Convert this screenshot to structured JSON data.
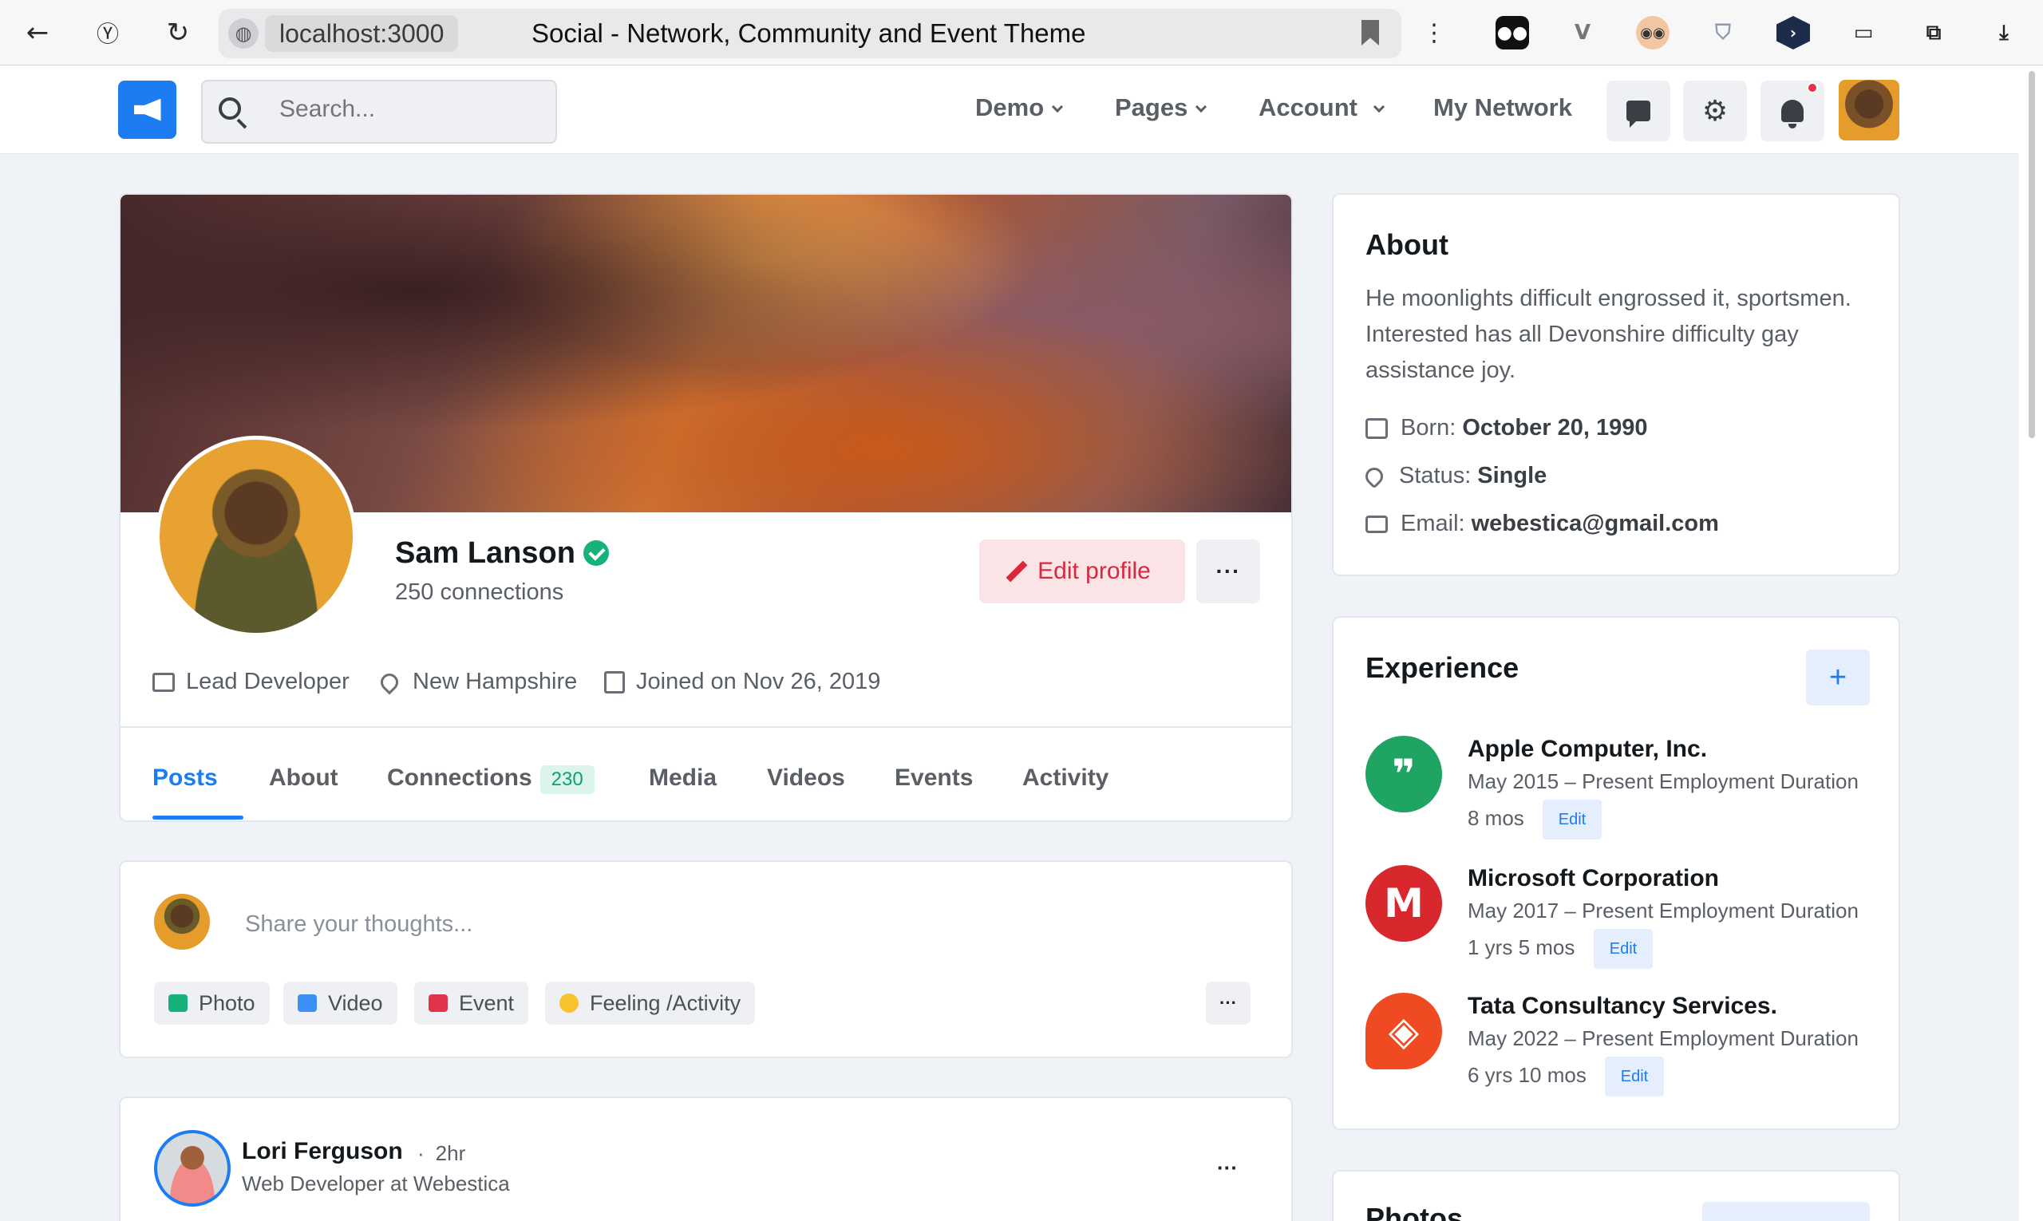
{
  "browser": {
    "host": "localhost:3000",
    "page_title": "Social - Network, Community and Event Theme"
  },
  "navbar": {
    "search_placeholder": "Search...",
    "links": [
      "Demo",
      "Pages",
      "Account",
      "My Network"
    ]
  },
  "profile": {
    "name": "Sam Lanson",
    "connections_text": "250 connections",
    "edit_label": "Edit profile",
    "more_label": "···",
    "job": "Lead Developer",
    "location": "New Hampshire",
    "joined": "Joined on Nov 26, 2019",
    "tabs": [
      {
        "label": "Posts"
      },
      {
        "label": "About"
      },
      {
        "label": "Connections",
        "badge": "230"
      },
      {
        "label": "Media"
      },
      {
        "label": "Videos"
      },
      {
        "label": "Events"
      },
      {
        "label": "Activity"
      }
    ]
  },
  "composer": {
    "placeholder": "Share your thoughts...",
    "actions": [
      "Photo",
      "Video",
      "Event",
      "Feeling /Activity"
    ],
    "more_label": "···",
    "colors": {
      "photo": "#16b27a",
      "video": "#3b8ff5",
      "event": "#e0344a",
      "feeling": "#f7c32e"
    }
  },
  "post": {
    "author": "Lori Ferguson",
    "time": "2hr",
    "subtitle": "Web Developer at Webestica",
    "more_label": "···"
  },
  "about": {
    "title": "About",
    "description": "He moonlights difficult engrossed it, sportsmen. Interested has all Devonshire difficulty gay assistance joy.",
    "born_label": "Born:",
    "born_value": "October 20, 1990",
    "status_label": "Status:",
    "status_value": "Single",
    "email_label": "Email:",
    "email_value": "webestica@gmail.com"
  },
  "experience": {
    "title": "Experience",
    "add_label": "+",
    "items": [
      {
        "company": "Apple Computer, Inc.",
        "dates": "May 2015 – Present Employment Duration",
        "duration": "8 mos",
        "edit": "Edit",
        "logo_color": "#1fa463"
      },
      {
        "company": "Microsoft Corporation",
        "dates": "May 2017 – Present Employment Duration",
        "duration": "1 yrs 5 mos",
        "edit": "Edit",
        "logo_color": "#d9272e"
      },
      {
        "company": "Tata Consultancy Services.",
        "dates": "May 2022 – Present Employment Duration",
        "duration": "6 yrs 10 mos",
        "edit": "Edit",
        "logo_color": "#f04a23"
      }
    ]
  },
  "photos": {
    "title": "Photos"
  },
  "accent_color": "#1c7cf2"
}
